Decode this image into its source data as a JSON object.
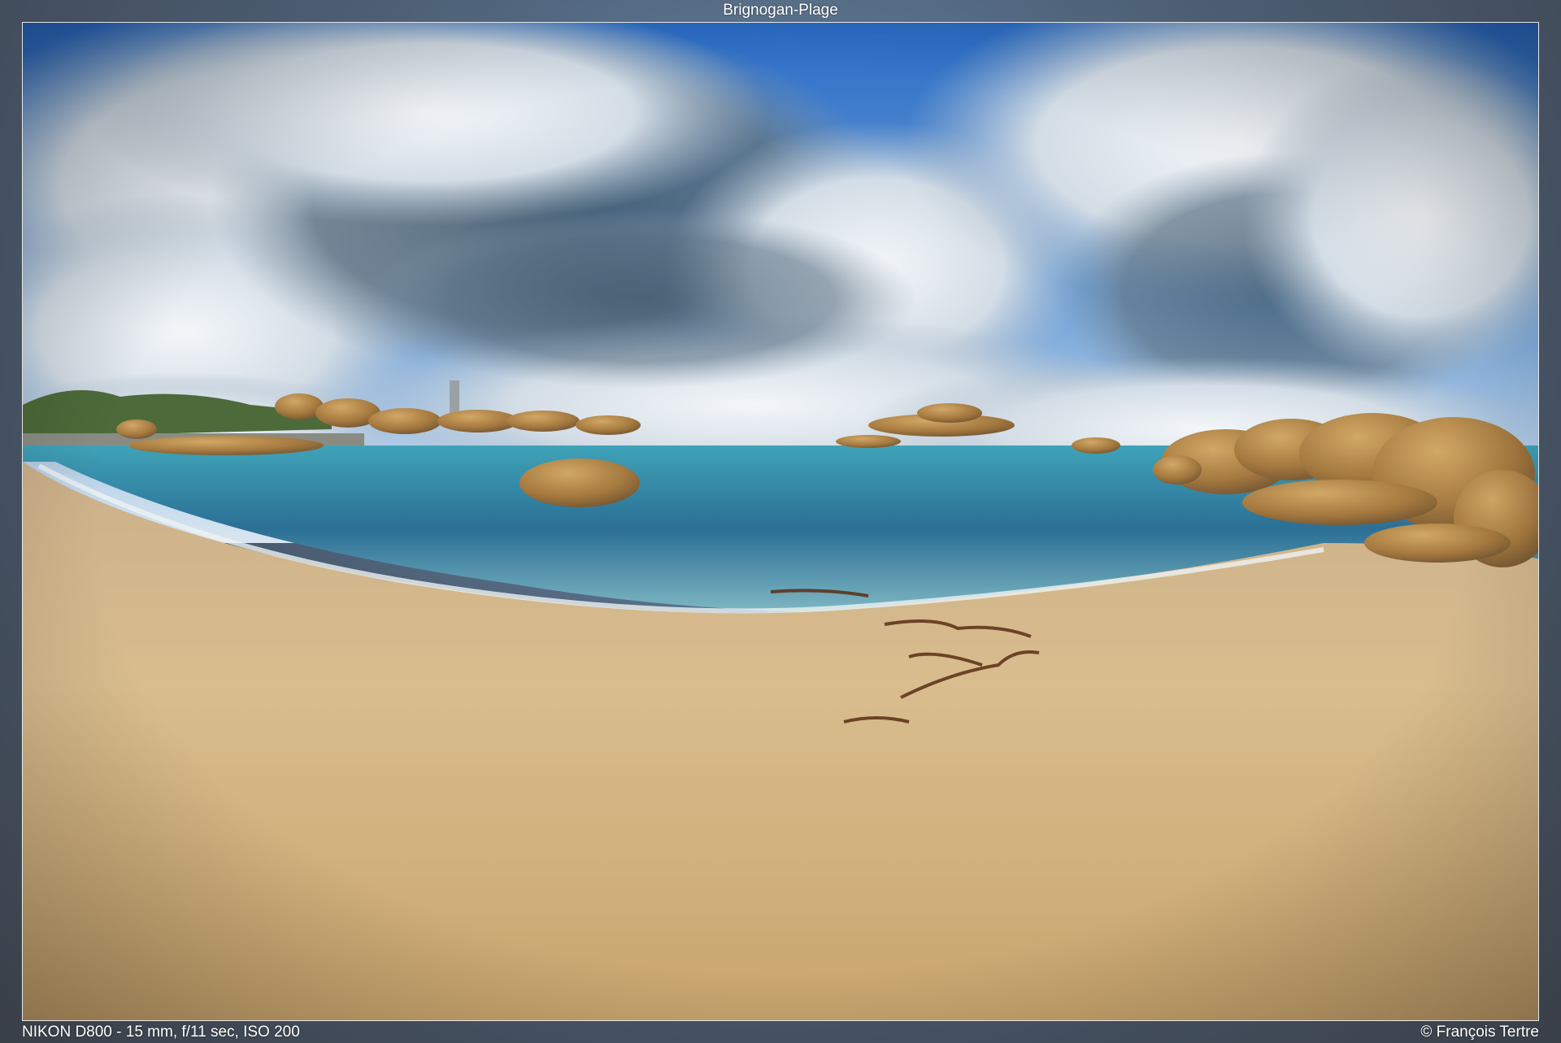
{
  "title": "Brignogan-Plage",
  "exif": "NIKON D800 - 15 mm, f/11 sec, ISO 200",
  "copyright": "© François Tertre",
  "colors": {
    "sky_blue": "#1f6fd0",
    "cloud": "#e9eef3",
    "cloud_shadow": "#4f6577",
    "sea": "#2f7fa0",
    "sand": "#d7b98a",
    "rock": "#b58a4c"
  }
}
